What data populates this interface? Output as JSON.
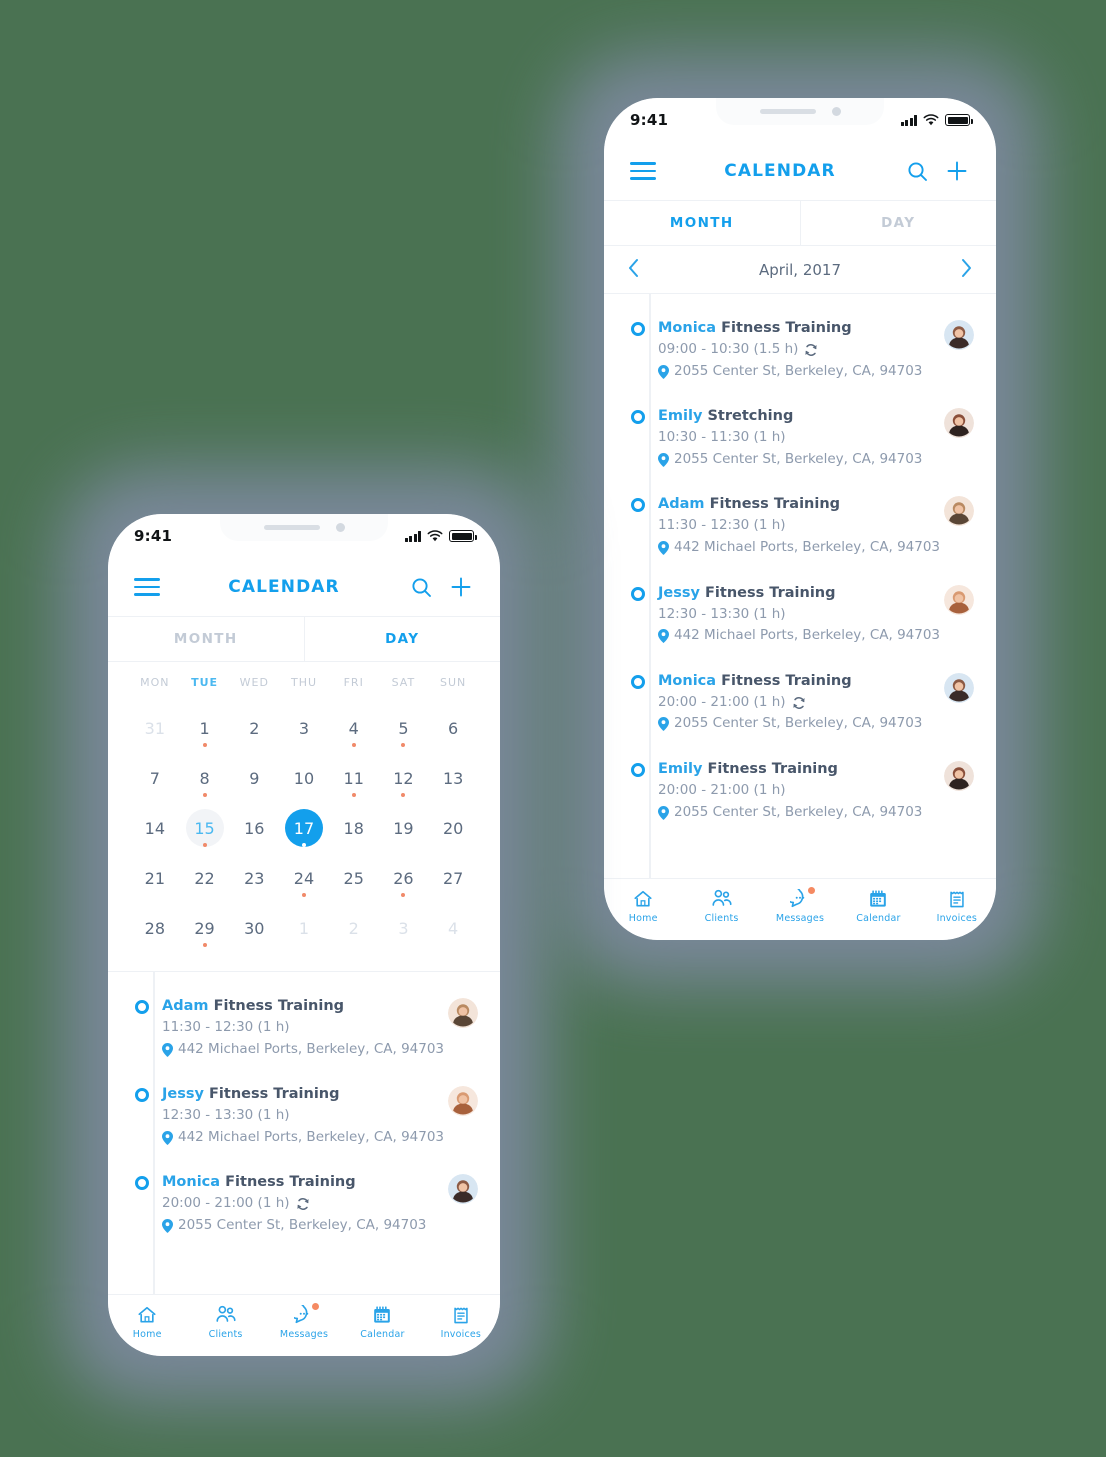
{
  "palette": {
    "background": "#4a7252",
    "shadow": "#7e8aa0",
    "accent": "#139fec",
    "accent_soft": "#2aa3e8",
    "text_dark": "#48566a",
    "text_muted": "#8d9aad",
    "tab_inactive": "#c3cbd6",
    "dot": "#f08a6a",
    "badge": "#f58a62"
  },
  "status_bar": {
    "time": "9:41",
    "signal_icon": "signal-bars-icon",
    "wifi_icon": "wifi-icon",
    "battery_icon": "battery-icon"
  },
  "app_bar": {
    "menu_icon": "hamburger-menu-icon",
    "title": "CALENDAR",
    "search_icon": "search-icon",
    "add_icon": "plus-icon"
  },
  "bottom_nav": {
    "items": [
      {
        "label": "Home",
        "icon": "home-icon",
        "badge": false
      },
      {
        "label": "Clients",
        "icon": "clients-icon",
        "badge": false
      },
      {
        "label": "Messages",
        "icon": "messages-icon",
        "badge": true
      },
      {
        "label": "Calendar",
        "icon": "calendar-icon",
        "badge": false
      },
      {
        "label": "Invoices",
        "icon": "invoices-icon",
        "badge": false
      }
    ]
  },
  "back_phone": {
    "tabs": [
      {
        "label": "MONTH",
        "active": true
      },
      {
        "label": "DAY",
        "active": false
      }
    ],
    "month_nav": {
      "prev_icon": "chevron-left-icon",
      "label": "April, 2017",
      "next_icon": "chevron-right-icon"
    },
    "events": [
      {
        "who": "Monica",
        "activity": "Fitness Training",
        "time": "09:00 - 10:30 (1.5 h)",
        "repeat": true,
        "location": "2055 Center St, Berkeley, CA, 94703",
        "avatar": "avatar-monica"
      },
      {
        "who": "Emily",
        "activity": "Stretching",
        "time": "10:30 - 11:30 (1 h)",
        "repeat": false,
        "location": "2055 Center St, Berkeley, CA, 94703",
        "avatar": "avatar-emily"
      },
      {
        "who": "Adam",
        "activity": "Fitness Training",
        "time": "11:30 - 12:30 (1 h)",
        "repeat": false,
        "location": "442 Michael Ports, Berkeley, CA, 94703",
        "avatar": "avatar-adam"
      },
      {
        "who": "Jessy",
        "activity": "Fitness Training",
        "time": "12:30 - 13:30 (1 h)",
        "repeat": false,
        "location": "442 Michael Ports, Berkeley, CA, 94703",
        "avatar": "avatar-jessy"
      },
      {
        "who": "Monica",
        "activity": "Fitness Training",
        "time": "20:00 - 21:00 (1 h)",
        "repeat": true,
        "location": "2055 Center St, Berkeley, CA, 94703",
        "avatar": "avatar-monica"
      },
      {
        "who": "Emily",
        "activity": "Fitness Training",
        "time": "20:00 - 21:00 (1 h)",
        "repeat": false,
        "location": "2055 Center St, Berkeley, CA, 94703",
        "avatar": "avatar-emily"
      }
    ]
  },
  "front_phone": {
    "tabs": [
      {
        "label": "MONTH",
        "active": false
      },
      {
        "label": "DAY",
        "active": true
      }
    ],
    "calendar": {
      "weekdays": [
        {
          "label": "MON",
          "highlight": false
        },
        {
          "label": "TUE",
          "highlight": true
        },
        {
          "label": "WED",
          "highlight": false
        },
        {
          "label": "THU",
          "highlight": false
        },
        {
          "label": "FRI",
          "highlight": false
        },
        {
          "label": "SAT",
          "highlight": false
        },
        {
          "label": "SUN",
          "highlight": false
        }
      ],
      "days": [
        {
          "n": "31",
          "muted": true,
          "dot": false,
          "today": false,
          "selected": false
        },
        {
          "n": "1",
          "muted": false,
          "dot": true,
          "today": false,
          "selected": false
        },
        {
          "n": "2",
          "muted": false,
          "dot": false,
          "today": false,
          "selected": false
        },
        {
          "n": "3",
          "muted": false,
          "dot": false,
          "today": false,
          "selected": false
        },
        {
          "n": "4",
          "muted": false,
          "dot": true,
          "today": false,
          "selected": false
        },
        {
          "n": "5",
          "muted": false,
          "dot": true,
          "today": false,
          "selected": false
        },
        {
          "n": "6",
          "muted": false,
          "dot": false,
          "today": false,
          "selected": false
        },
        {
          "n": "7",
          "muted": false,
          "dot": false,
          "today": false,
          "selected": false
        },
        {
          "n": "8",
          "muted": false,
          "dot": true,
          "today": false,
          "selected": false
        },
        {
          "n": "9",
          "muted": false,
          "dot": false,
          "today": false,
          "selected": false
        },
        {
          "n": "10",
          "muted": false,
          "dot": false,
          "today": false,
          "selected": false
        },
        {
          "n": "11",
          "muted": false,
          "dot": true,
          "today": false,
          "selected": false
        },
        {
          "n": "12",
          "muted": false,
          "dot": true,
          "today": false,
          "selected": false
        },
        {
          "n": "13",
          "muted": false,
          "dot": false,
          "today": false,
          "selected": false
        },
        {
          "n": "14",
          "muted": false,
          "dot": false,
          "today": false,
          "selected": false
        },
        {
          "n": "15",
          "muted": false,
          "dot": true,
          "today": true,
          "selected": false
        },
        {
          "n": "16",
          "muted": false,
          "dot": false,
          "today": false,
          "selected": false
        },
        {
          "n": "17",
          "muted": false,
          "dot": true,
          "today": false,
          "selected": true
        },
        {
          "n": "18",
          "muted": false,
          "dot": false,
          "today": false,
          "selected": false
        },
        {
          "n": "19",
          "muted": false,
          "dot": false,
          "today": false,
          "selected": false
        },
        {
          "n": "20",
          "muted": false,
          "dot": false,
          "today": false,
          "selected": false
        },
        {
          "n": "21",
          "muted": false,
          "dot": false,
          "today": false,
          "selected": false
        },
        {
          "n": "22",
          "muted": false,
          "dot": false,
          "today": false,
          "selected": false
        },
        {
          "n": "23",
          "muted": false,
          "dot": false,
          "today": false,
          "selected": false
        },
        {
          "n": "24",
          "muted": false,
          "dot": true,
          "today": false,
          "selected": false
        },
        {
          "n": "25",
          "muted": false,
          "dot": false,
          "today": false,
          "selected": false
        },
        {
          "n": "26",
          "muted": false,
          "dot": true,
          "today": false,
          "selected": false
        },
        {
          "n": "27",
          "muted": false,
          "dot": false,
          "today": false,
          "selected": false
        },
        {
          "n": "28",
          "muted": false,
          "dot": false,
          "today": false,
          "selected": false
        },
        {
          "n": "29",
          "muted": false,
          "dot": true,
          "today": false,
          "selected": false
        },
        {
          "n": "30",
          "muted": false,
          "dot": false,
          "today": false,
          "selected": false
        },
        {
          "n": "1",
          "muted": true,
          "dot": false,
          "today": false,
          "selected": false
        },
        {
          "n": "2",
          "muted": true,
          "dot": false,
          "today": false,
          "selected": false
        },
        {
          "n": "3",
          "muted": true,
          "dot": false,
          "today": false,
          "selected": false
        },
        {
          "n": "4",
          "muted": true,
          "dot": false,
          "today": false,
          "selected": false
        }
      ]
    },
    "events": [
      {
        "who": "Adam",
        "activity": "Fitness Training",
        "time": "11:30 - 12:30 (1 h)",
        "repeat": false,
        "location": "442 Michael Ports, Berkeley, CA, 94703",
        "avatar": "avatar-adam"
      },
      {
        "who": "Jessy",
        "activity": "Fitness Training",
        "time": "12:30 - 13:30 (1 h)",
        "repeat": false,
        "location": "442 Michael Ports, Berkeley, CA, 94703",
        "avatar": "avatar-jessy"
      },
      {
        "who": "Monica",
        "activity": "Fitness Training",
        "time": "20:00 - 21:00 (1 h)",
        "repeat": true,
        "location": "2055 Center St, Berkeley, CA, 94703",
        "avatar": "avatar-monica"
      }
    ]
  }
}
